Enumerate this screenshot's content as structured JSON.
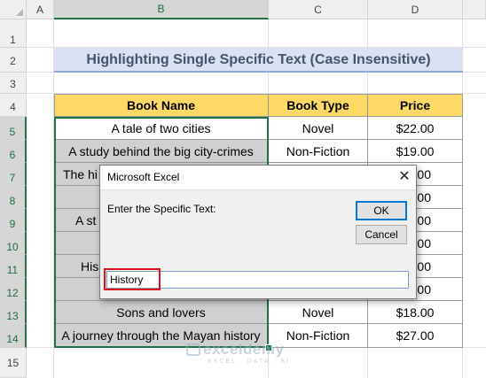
{
  "columns": [
    "A",
    "B",
    "C",
    "D"
  ],
  "rows": [
    "1",
    "2",
    "3",
    "4",
    "5",
    "6",
    "7",
    "8",
    "9",
    "10",
    "11",
    "12",
    "13",
    "14",
    "15"
  ],
  "sheet_title": "Highlighting Single Specific Text (Case Insensitive)",
  "table": {
    "headers": [
      "Book Name",
      "Book Type",
      "Price"
    ],
    "rows": [
      [
        "A tale of two cities",
        "Novel",
        "$22.00"
      ],
      [
        "A study behind the big city-crimes",
        "Non-Fiction",
        "$19.00"
      ],
      [
        "The hi",
        "",
        ""
      ],
      [
        "",
        "",
        ""
      ],
      [
        "A st",
        "",
        ""
      ],
      [
        "",
        "",
        ""
      ],
      [
        "His",
        "",
        ""
      ],
      [
        "",
        "",
        ""
      ],
      [
        "Sons and lovers",
        "Novel",
        "$18.00"
      ],
      [
        "A journey through the Mayan history",
        "Non-Fiction",
        "$27.00"
      ]
    ],
    "partial_price_glyphs": [
      "00",
      "00",
      "00",
      "00",
      "00",
      "00"
    ]
  },
  "dialog": {
    "title": "Microsoft Excel",
    "close_glyph": "✕",
    "prompt": "Enter the Specific Text:",
    "ok_label": "OK",
    "cancel_label": "Cancel",
    "input_value": "History"
  },
  "watermark": {
    "brand": "exceldemy",
    "tagline": "EXCEL · DATA · BI"
  },
  "colors": {
    "header_fill": "#ffd966",
    "highlight_fill": "#d0d0d0",
    "title_fill": "#d9e1f2",
    "title_text": "#44546a",
    "selection": "#217346",
    "annotation_box": "#e0101a"
  }
}
